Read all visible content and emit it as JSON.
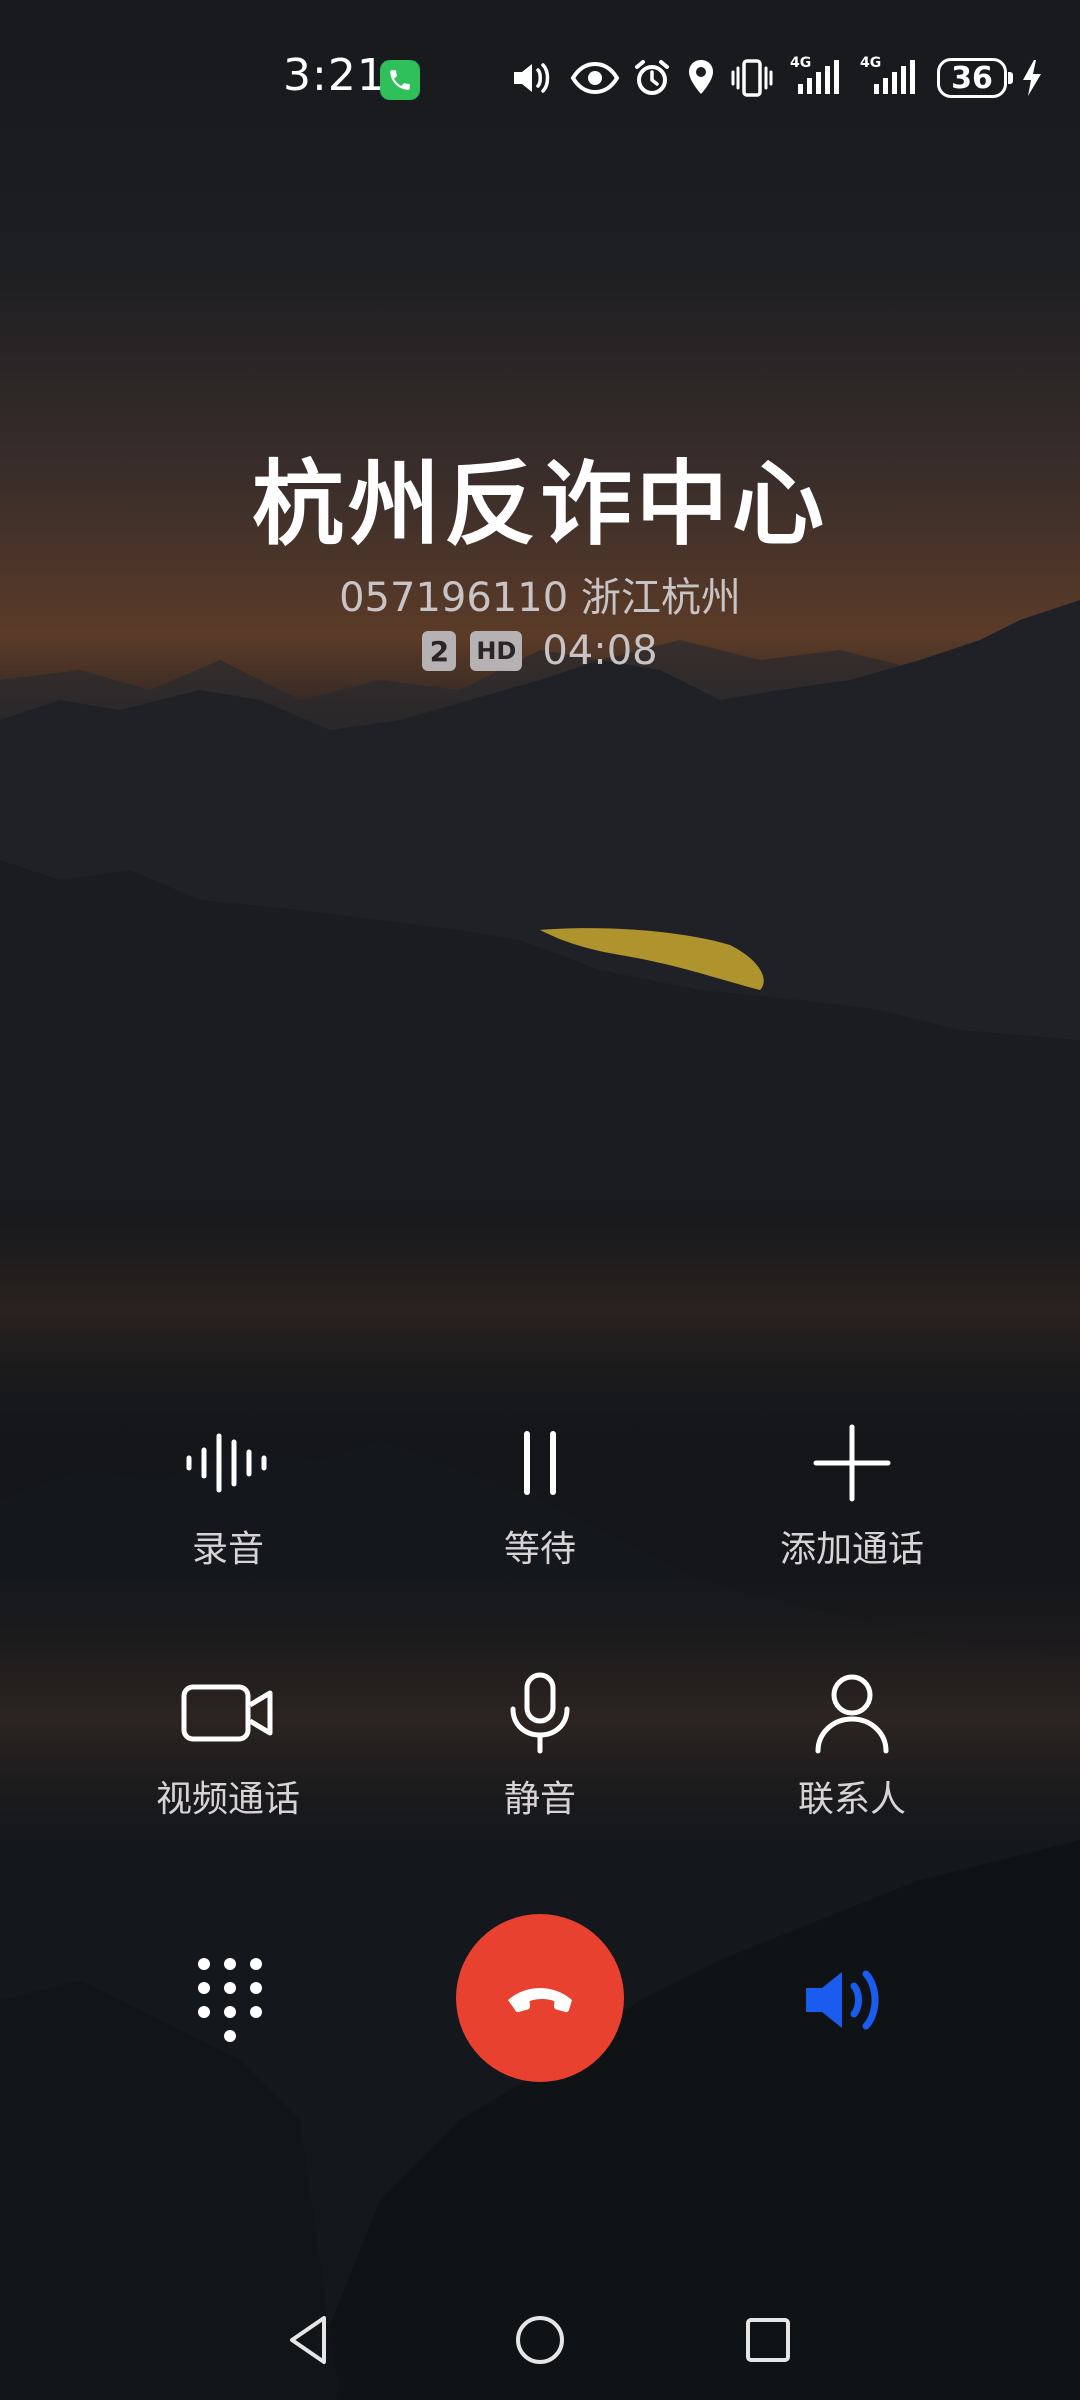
{
  "status_bar": {
    "time": "3:21",
    "network_1": "4G",
    "network_2": "4G",
    "battery": "36"
  },
  "call": {
    "caller_name": "杭州反诈中心",
    "number_location": "057196110 浙江杭州",
    "sim_badge": "2",
    "hd_badge": "HD",
    "duration": "04:08"
  },
  "actions": {
    "record": "录音",
    "hold": "等待",
    "add_call": "添加通话",
    "video_call": "视频通话",
    "mute": "静音",
    "contacts": "联系人"
  },
  "colors": {
    "end_call": "#e8412f",
    "speaker_active": "#1a5cf0",
    "call_indicator": "#2fbf5b"
  }
}
